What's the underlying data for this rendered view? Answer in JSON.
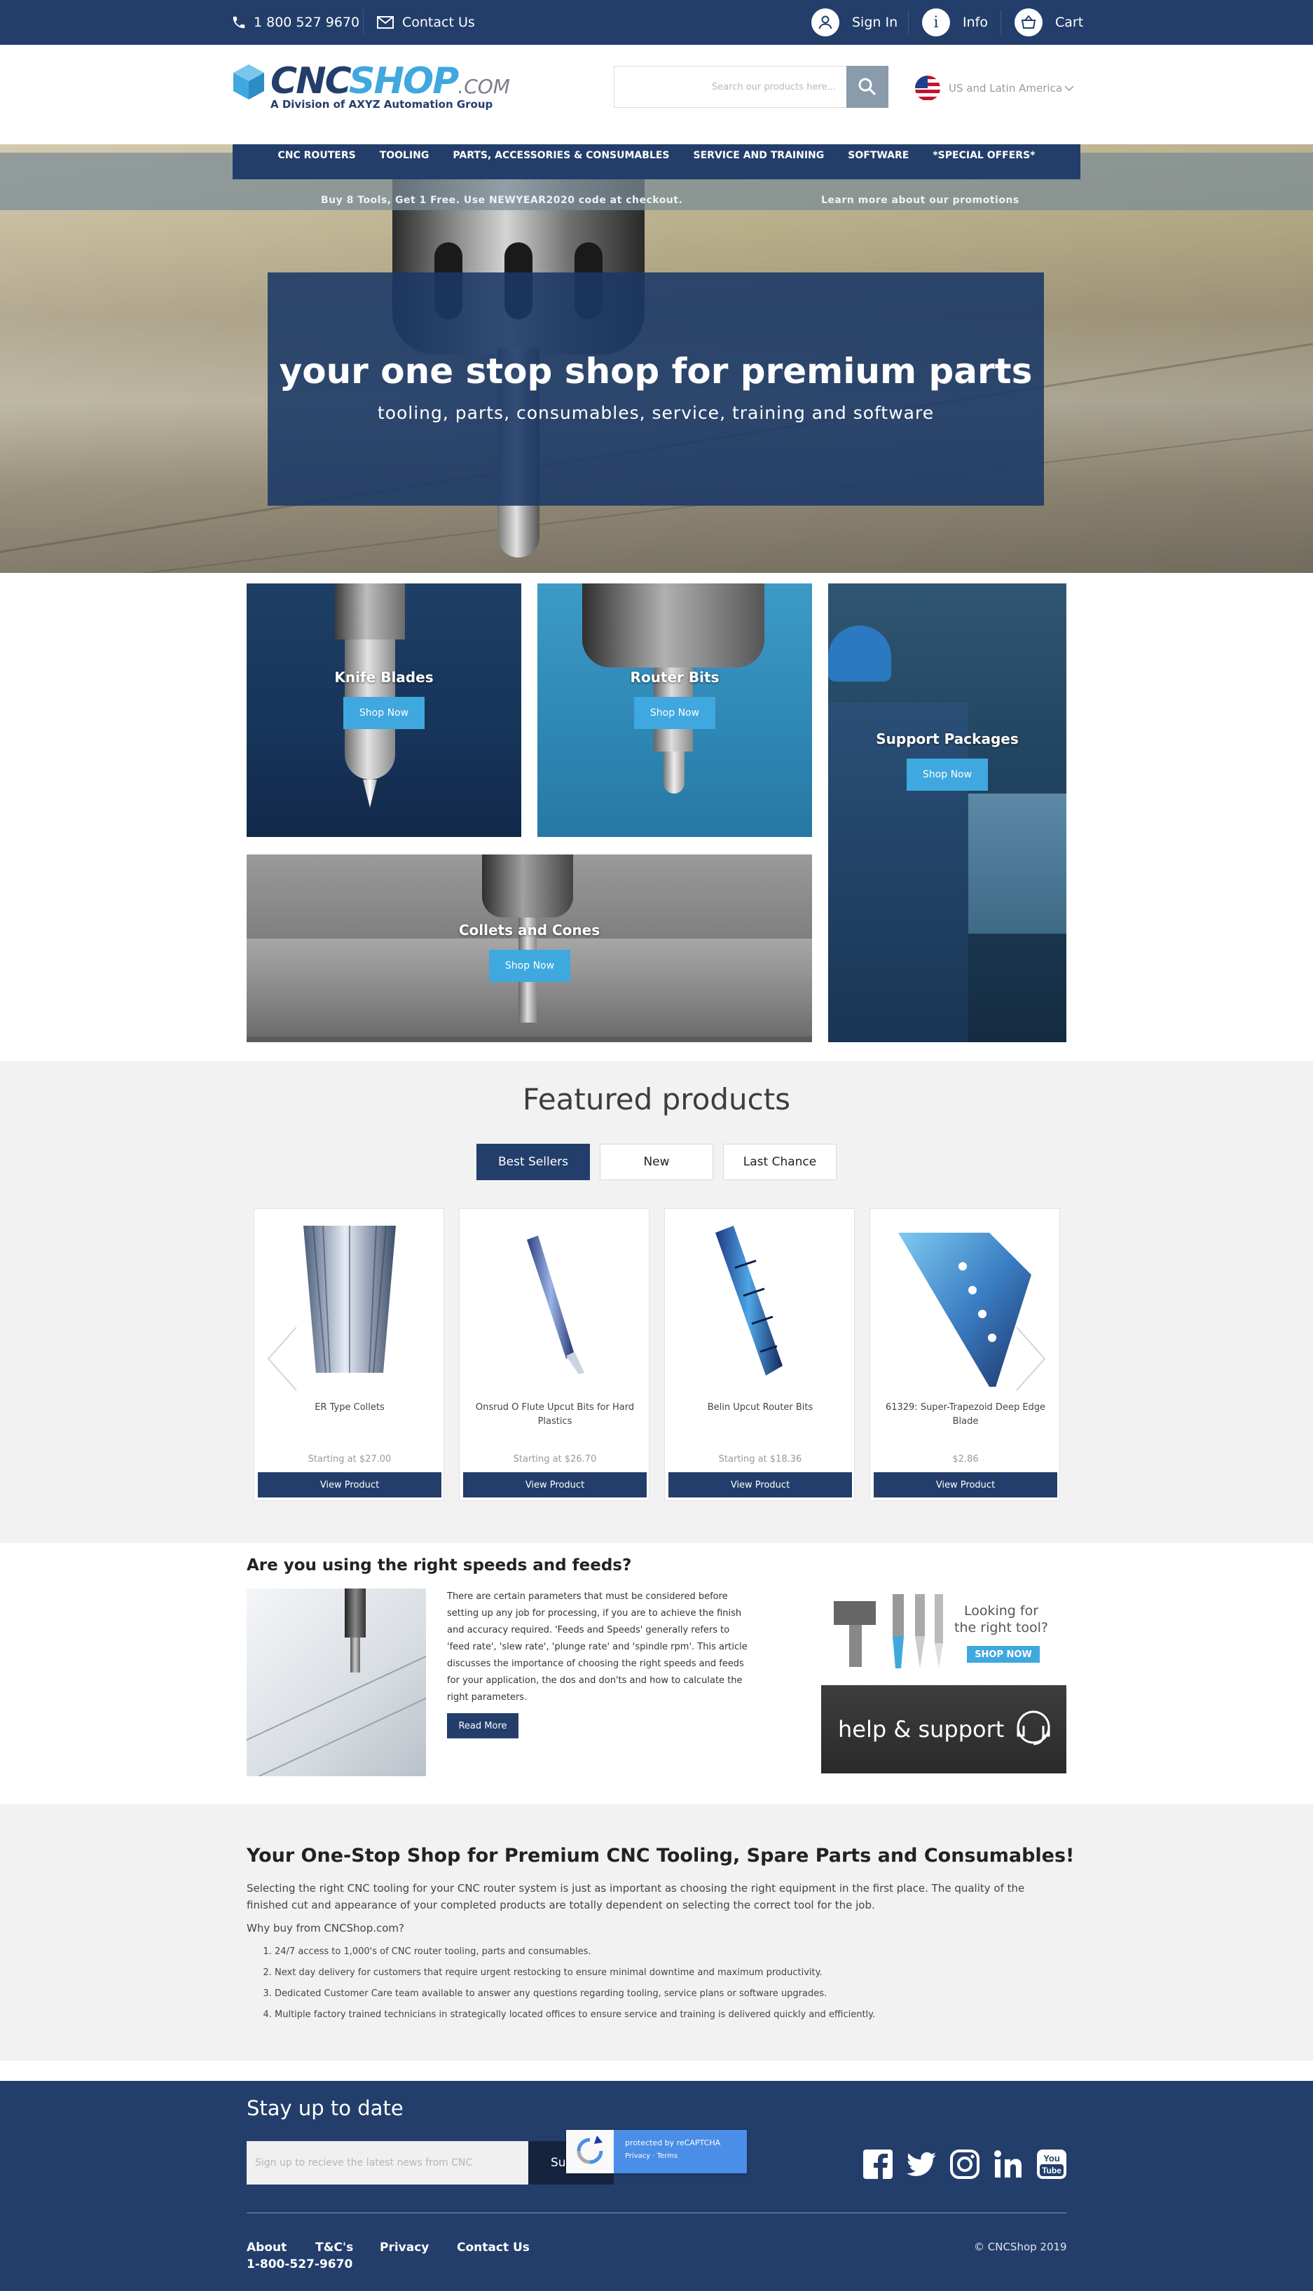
{
  "topbar": {
    "phone": "1 800 527 9670",
    "contact": "Contact Us",
    "sign_in": "Sign In",
    "info": "Info",
    "cart": "Cart"
  },
  "header": {
    "logo_cnc": "CNC",
    "logo_shop": "SHOP",
    "logo_com": ".COM",
    "logo_tagline": "A Division of AXYZ Automation Group",
    "search_placeholder": "Search our products here...",
    "region": "US and Latin America"
  },
  "nav": {
    "items": [
      "CNC ROUTERS",
      "TOOLING",
      "PARTS, ACCESSORIES & CONSUMABLES",
      "SERVICE AND TRAINING",
      "SOFTWARE",
      "*SPECIAL OFFERS*"
    ]
  },
  "promo": {
    "left": "Buy 8 Tools, Get 1 Free. Use NEWYEAR2020 code at checkout.",
    "right": "Learn more about our promotions"
  },
  "hero": {
    "title": "your one stop shop for premium parts",
    "subtitle": "tooling, parts, consumables, service, training and software"
  },
  "categories": [
    {
      "label": "Knife Blades",
      "button": "Shop Now"
    },
    {
      "label": "Router Bits",
      "button": "Shop Now"
    },
    {
      "label": "Support Packages",
      "button": "Shop Now"
    },
    {
      "label": "Collets and Cones",
      "button": "Shop Now"
    }
  ],
  "featured": {
    "title": "Featured products",
    "tabs": [
      "Best Sellers",
      "New",
      "Last Chance"
    ],
    "active_tab": "Best Sellers",
    "products": [
      {
        "name": "ER Type Collets",
        "price": "Starting at $27.00",
        "button": "View Product"
      },
      {
        "name": "Onsrud O Flute Upcut Bits for Hard Plastics",
        "price": "Starting at $26.70",
        "button": "View Product"
      },
      {
        "name": "Belin Upcut Router Bits",
        "price": "Starting at $18.36",
        "button": "View Product"
      },
      {
        "name": "61329: Super-Trapezoid Deep Edge Blade",
        "price": "$2.86",
        "button": "View Product"
      }
    ]
  },
  "speeds_feeds": {
    "title": "Are you using the right speeds and feeds?",
    "body": "There are certain parameters that must be considered before setting up any job for processing, if you are to achieve the finish and accuracy required. 'Feeds and Speeds' generally refers to 'feed rate', 'slew rate', 'plunge rate' and 'spindle rpm'. This article discusses the importance of choosing the right speeds and feeds for your application, the dos and don'ts and how to calculate the right parameters.",
    "button": "Read More"
  },
  "ads": {
    "tool_line1": "Looking for",
    "tool_line2": "the right tool?",
    "tool_button": "SHOP NOW",
    "help": "help & support"
  },
  "about": {
    "title": "Your One-Stop Shop for Premium CNC Tooling, Spare Parts and Consumables!",
    "intro": "Selecting the right CNC tooling for your CNC router system is just as important as choosing the right equipment in the first place. The quality of the finished cut and appearance of your completed products are totally dependent on selecting the correct tool for the job.",
    "why": "Why buy from CNCShop.com?",
    "points": [
      "24/7 access to 1,000's of CNC router tooling, parts and consumables.",
      "Next day delivery for customers that require urgent restocking to ensure minimal downtime and maximum productivity.",
      "Dedicated Customer Care team available to answer any questions regarding tooling, service plans or software upgrades.",
      "Multiple factory trained technicians in strategically located offices to ensure service and training is delivered quickly and efficiently."
    ]
  },
  "footer": {
    "stay": "Stay up to date",
    "email_placeholder": "Sign up to recieve the latest news from CNC",
    "subscribe": "Su",
    "captcha_line1": "protected by reCAPTCHA",
    "captcha_line2": "Privacy · Terms",
    "links": [
      "About",
      "T&C's",
      "Privacy",
      "Contact Us"
    ],
    "phone": "1-800-527-9670",
    "copyright": "© CNCShop 2019",
    "social": [
      "facebook-icon",
      "twitter-icon",
      "instagram-icon",
      "linkedin-icon",
      "youtube-icon"
    ]
  },
  "colors": {
    "navy": "#233e6b",
    "accent": "#3fa8de",
    "light_bg": "#f2f2f2"
  }
}
